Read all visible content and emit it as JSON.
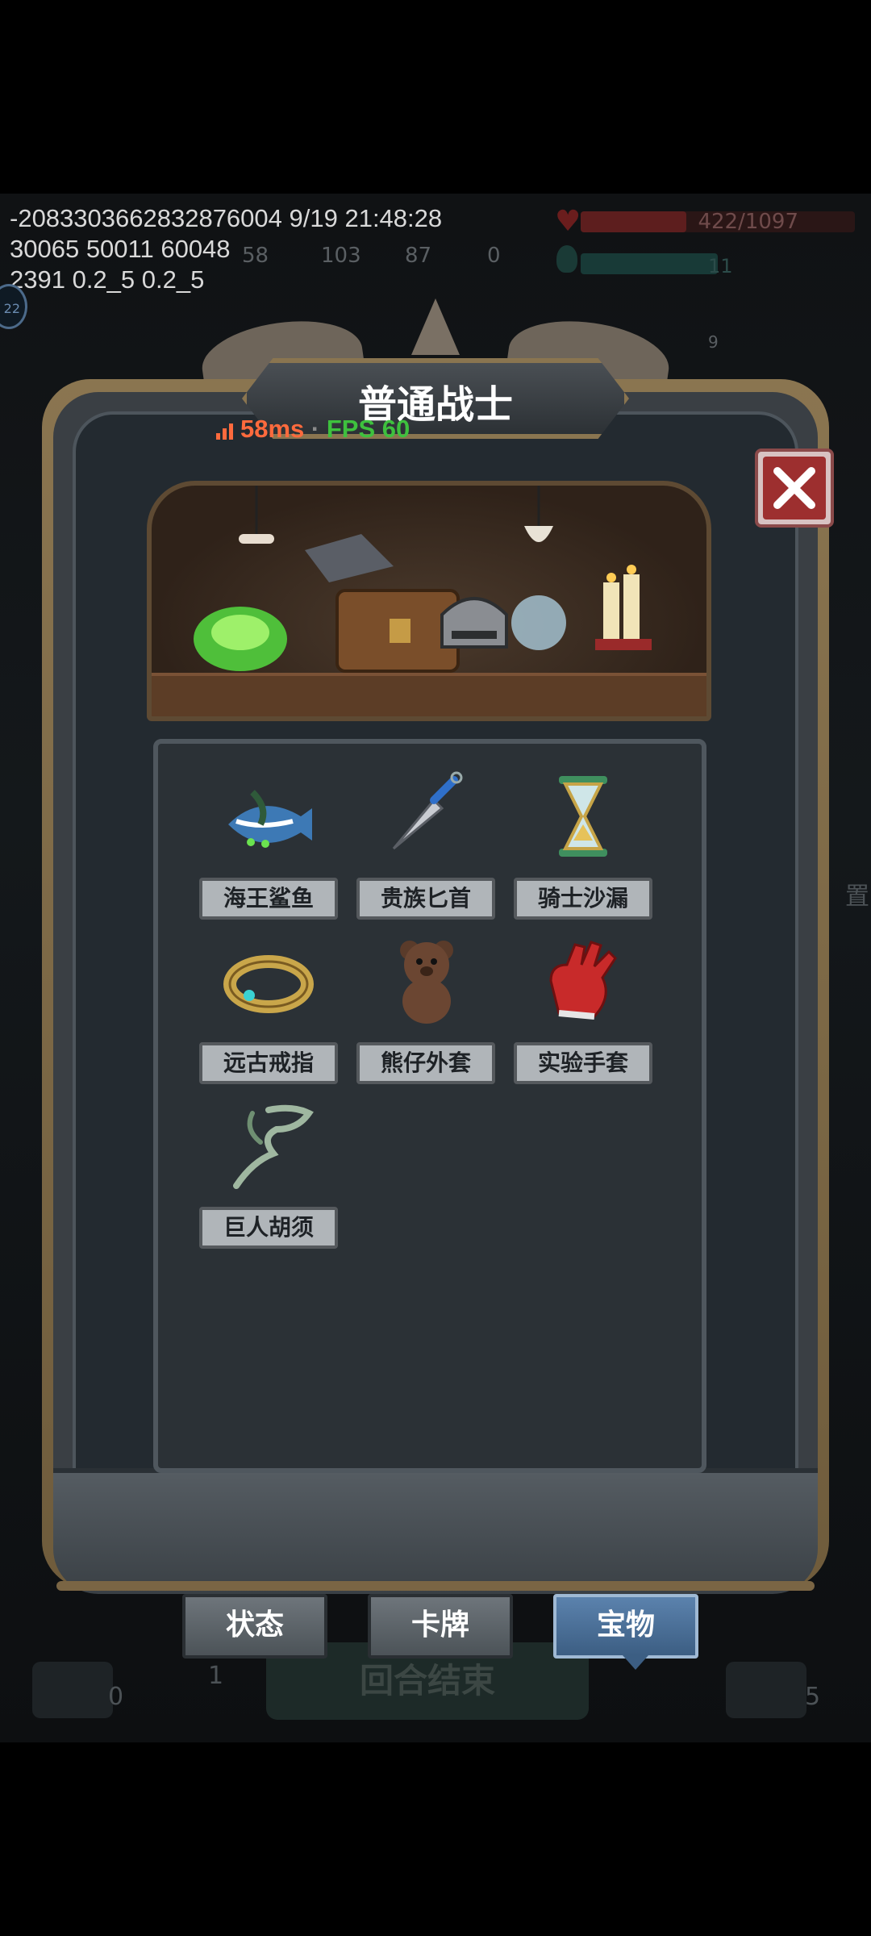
{
  "debug": {
    "line1": "-2083303662832876004 9/19 21:48:28",
    "line2": "30065 50011 60048",
    "line3": "2391 0.2_5 0.2_5",
    "badge": "22"
  },
  "hud": {
    "hp_text": "422/1097",
    "hp_fraction": 0.385,
    "mp_text": "11",
    "stats": [
      "58",
      "103",
      "87",
      "0"
    ],
    "counter": "9"
  },
  "panel": {
    "title": "普通战士"
  },
  "perf": {
    "ping": "58ms",
    "separator": "·",
    "fps": "FPS 60"
  },
  "items": [
    {
      "label": "海王鲨鱼",
      "icon": "shark-fish-icon"
    },
    {
      "label": "贵族匕首",
      "icon": "dagger-icon"
    },
    {
      "label": "骑士沙漏",
      "icon": "hourglass-icon"
    },
    {
      "label": "远古戒指",
      "icon": "ring-icon"
    },
    {
      "label": "熊仔外套",
      "icon": "teddy-bear-icon"
    },
    {
      "label": "实验手套",
      "icon": "red-glove-icon"
    },
    {
      "label": "巨人胡须",
      "icon": "giant-beard-icon"
    }
  ],
  "tabs": {
    "status": "状态",
    "cards": "卡牌",
    "treasure": "宝物",
    "active": "treasure"
  },
  "bottom": {
    "end_turn": "回合结束",
    "draw_count": "0",
    "energy": "1",
    "discard_count": "5",
    "right_label": "置"
  },
  "colors": {
    "frame_gold": "#8a7550",
    "panel_dark": "#232a30",
    "active_tab": "#4a6f97",
    "close_red": "#9d2f2f"
  }
}
